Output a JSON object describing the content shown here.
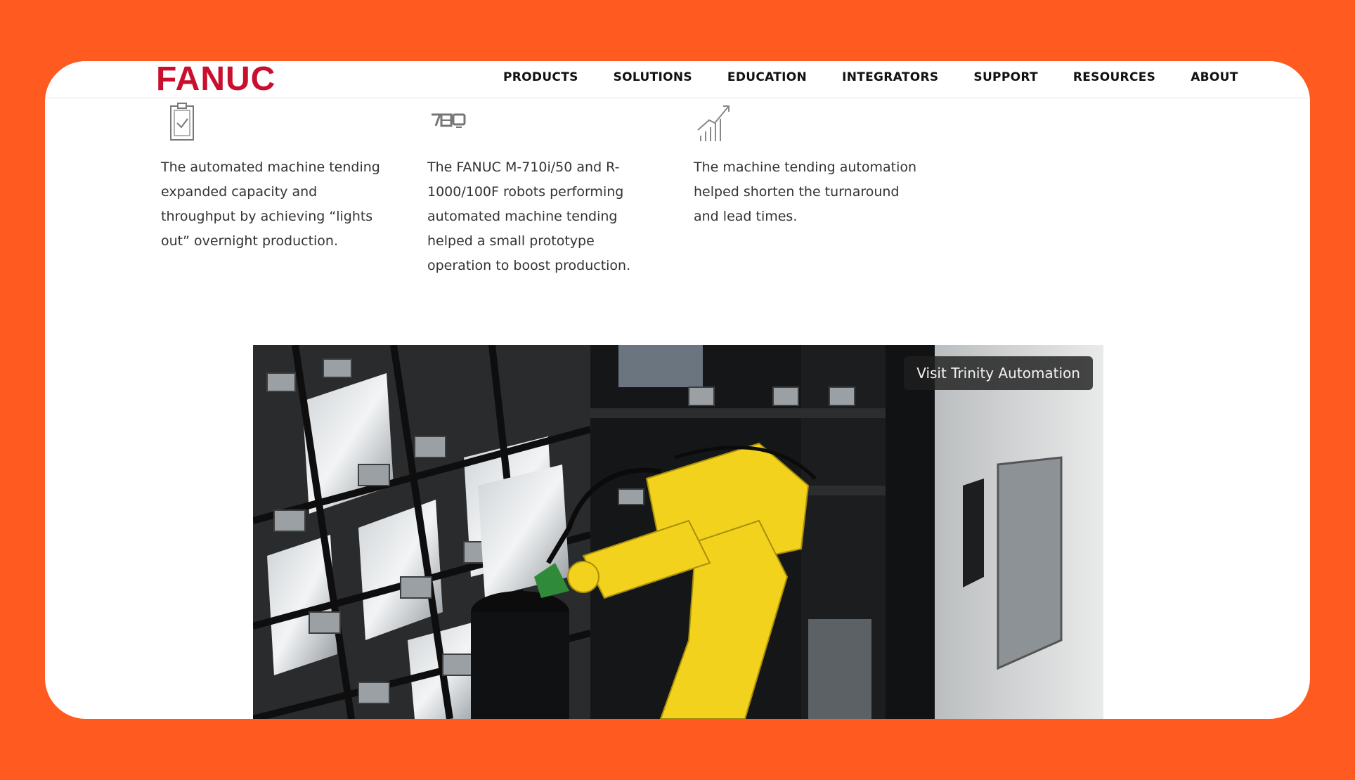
{
  "brand": {
    "logo_text": "FANUC",
    "color": "#c8102e"
  },
  "nav": {
    "items": [
      {
        "label": "PRODUCTS"
      },
      {
        "label": "SOLUTIONS"
      },
      {
        "label": "EDUCATION"
      },
      {
        "label": "INTEGRATORS"
      },
      {
        "label": "SUPPORT"
      },
      {
        "label": "RESOURCES"
      },
      {
        "label": "ABOUT"
      }
    ]
  },
  "features": [
    {
      "icon": "clipboard-check-icon",
      "text": "The automated machine tending expanded capacity and throughput by achieving “lights out” overnight production."
    },
    {
      "icon": "robot-machine-icon",
      "text": "The FANUC M-710i/50 and R-1000/100F robots performing automated machine tending helped a small prototype operation to boost production."
    },
    {
      "icon": "growth-chart-icon",
      "text": "The machine tending automation helped shorten the turnaround and lead times."
    }
  ],
  "video": {
    "cta_label": "Visit Trinity Automation"
  },
  "colors": {
    "background": "#ff5a1f",
    "card": "#ffffff",
    "robot": "#f2d21c"
  }
}
